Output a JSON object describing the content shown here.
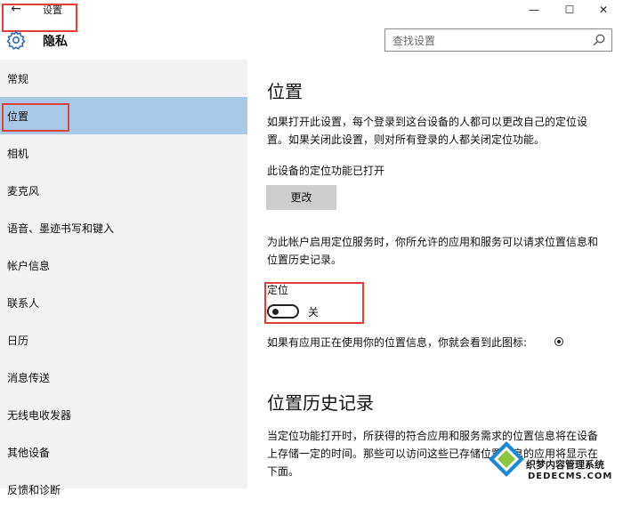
{
  "window": {
    "title": "设置",
    "back_glyph": "←",
    "minimize_glyph": "—",
    "maximize_glyph": "☐",
    "close_glyph": "✕"
  },
  "header": {
    "icon": "gear-icon",
    "title": "隐私",
    "search_placeholder": "查找设置"
  },
  "sidebar": {
    "items": [
      {
        "label": "常规"
      },
      {
        "label": "位置",
        "selected": true
      },
      {
        "label": "相机"
      },
      {
        "label": "麦克风"
      },
      {
        "label": "语音、墨迹书写和键入"
      },
      {
        "label": "帐户信息"
      },
      {
        "label": "联系人"
      },
      {
        "label": "日历"
      },
      {
        "label": "消息传送"
      },
      {
        "label": "无线电收发器"
      },
      {
        "label": "其他设备"
      },
      {
        "label": "反馈和诊断"
      }
    ]
  },
  "main": {
    "title": "位置",
    "intro": "如果打开此设置，每个登录到这台设备的人都可以更改自己的定位设置。如果关闭此设置，则对所有登录的人都关闭定位功能。",
    "device_status": "此设备的定位功能已打开",
    "change_button": "更改",
    "account_desc": "为此帐户启用定位服务时，你所允许的应用和服务可以请求位置信息和位置历史记录。",
    "location_label": "定位",
    "location_toggle_state": "关",
    "location_toggle_on": false,
    "icon_hint": "如果有应用正在使用你的位置信息，你就会看到此图标:",
    "history_title": "位置历史记录",
    "history_desc": "当定位功能打开时，所获得的符合应用和服务需求的位置信息将在设备上存储一定的时间。那些可以访问这些已存储位置信息的应用将显示在下面。"
  },
  "watermark": {
    "line1": "织梦内容管理系统",
    "line2": "DEDECMS.COM"
  },
  "colors": {
    "accent_selected": "#a8c8e6",
    "highlight_border": "#e0403a",
    "sidebar_bg": "#f2f2f2",
    "button_bg": "#cdcdcd"
  }
}
